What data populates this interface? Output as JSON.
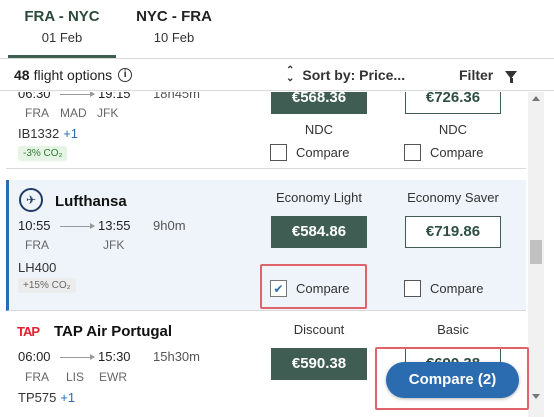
{
  "tabs": [
    {
      "route": "FRA - NYC",
      "date": "01 Feb"
    },
    {
      "route": "NYC - FRA",
      "date": "10 Feb"
    }
  ],
  "header": {
    "count": "48",
    "count_label": "flight options",
    "sort_label": "Sort by: Price...",
    "filter_label": "Filter"
  },
  "flights": [
    {
      "depart": "06:30",
      "arrive": "19:15",
      "duration": "18h45m",
      "airports": [
        "FRA",
        "MAD",
        "JFK"
      ],
      "flight_number": "IB1332",
      "more": "+1",
      "co2": "-3% CO₂",
      "fares": [
        {
          "price": "€568.36",
          "label": "NDC",
          "compare_label": "Compare",
          "checked": false
        },
        {
          "price": "€726.36",
          "label": "NDC",
          "compare_label": "Compare",
          "checked": false
        }
      ]
    },
    {
      "airline": "Lufthansa",
      "depart": "10:55",
      "arrive": "13:55",
      "duration": "9h0m",
      "airports": [
        "FRA",
        "JFK"
      ],
      "flight_number": "LH400",
      "co2": "+15% CO₂",
      "fares": [
        {
          "label": "Economy Light",
          "price": "€584.86",
          "compare_label": "Compare",
          "checked": true
        },
        {
          "label": "Economy Saver",
          "price": "€719.86",
          "compare_label": "Compare",
          "checked": false
        }
      ]
    },
    {
      "airline": "TAP Air Portugal",
      "logo_text": "TAP",
      "depart": "06:00",
      "arrive": "15:30",
      "duration": "15h30m",
      "airports": [
        "FRA",
        "LIS",
        "EWR"
      ],
      "flight_number": "TP575",
      "more": "+1",
      "fares": [
        {
          "label": "Discount",
          "price": "€590.38"
        },
        {
          "label": "Basic",
          "price": "€690.38"
        }
      ]
    }
  ],
  "compare_button": "Compare (2)",
  "colors": {
    "accent": "#2b6cb0",
    "price_dark": "#3f5d52",
    "highlight": "#e0636b"
  }
}
